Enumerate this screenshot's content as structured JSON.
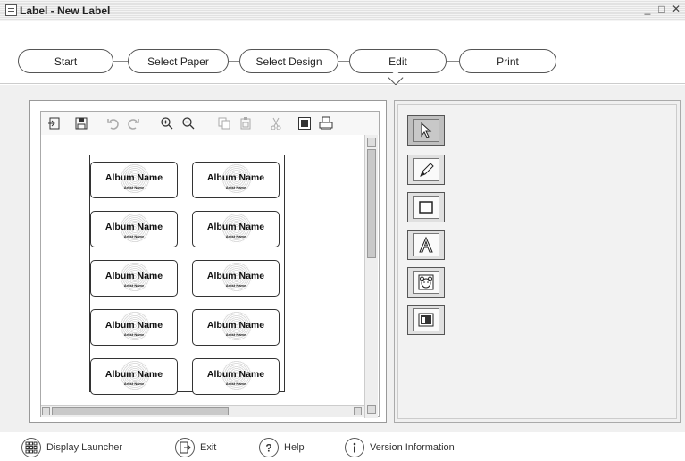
{
  "window": {
    "title": "Label - New Label",
    "controls": {
      "minimize": "_",
      "maximize": "□",
      "close": "✕"
    }
  },
  "steps": [
    {
      "label": "Start"
    },
    {
      "label": "Select Paper"
    },
    {
      "label": "Select Design"
    },
    {
      "label": "Edit",
      "active": true
    },
    {
      "label": "Print"
    }
  ],
  "canvas_toolbar": [
    {
      "icon": "import-icon"
    },
    {
      "icon": "save-icon"
    },
    {
      "icon": "undo-icon"
    },
    {
      "icon": "redo-icon"
    },
    {
      "icon": "zoom-in-icon"
    },
    {
      "icon": "zoom-out-icon"
    },
    {
      "icon": "copy-icon"
    },
    {
      "icon": "paste-icon"
    },
    {
      "icon": "cut-icon"
    },
    {
      "icon": "fill-icon"
    },
    {
      "icon": "print-icon"
    }
  ],
  "labels": [
    {
      "title": "Album Name",
      "subtitle": "Artist Name"
    },
    {
      "title": "Album Name",
      "subtitle": "Artist Name"
    },
    {
      "title": "Album Name",
      "subtitle": "Artist Name"
    },
    {
      "title": "Album Name",
      "subtitle": "Artist Name"
    },
    {
      "title": "Album Name",
      "subtitle": "Artist Name"
    },
    {
      "title": "Album Name",
      "subtitle": "Artist Name"
    },
    {
      "title": "Album Name",
      "subtitle": "Artist Name"
    },
    {
      "title": "Album Name",
      "subtitle": "Artist Name"
    },
    {
      "title": "Album Name",
      "subtitle": "Artist Name"
    },
    {
      "title": "Album Name",
      "subtitle": "Artist Name"
    }
  ],
  "tools": [
    {
      "icon": "pointer-icon",
      "active": true
    },
    {
      "icon": "pencil-icon"
    },
    {
      "icon": "rectangle-icon"
    },
    {
      "icon": "text-icon"
    },
    {
      "icon": "clipart-icon"
    },
    {
      "icon": "image-icon"
    }
  ],
  "bottom": {
    "display_launcher": "Display Launcher",
    "exit": "Exit",
    "help": "Help",
    "version": "Version Information"
  }
}
